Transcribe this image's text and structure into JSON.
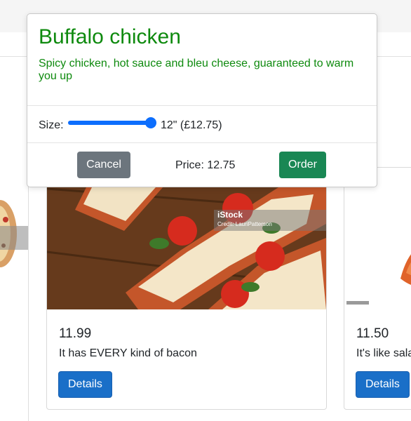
{
  "modal": {
    "title": "Buffalo chicken",
    "description": "Spicy chicken, hot sauce and bleu cheese, guaranteed to warm you up",
    "size_label": "Size:",
    "size_slider_level": 1.0,
    "size_value": "12\" (£12.75)",
    "cancel_label": "Cancel",
    "price_text": "Price: 12.75",
    "order_label": "Order",
    "colors": {
      "title": "#0e8a0e",
      "cancel": "#6c757d",
      "order": "#198754",
      "slider": "#0d6efd"
    }
  },
  "cards": [
    {
      "image_watermark": "iStock",
      "image_credit": "Credit: LauriPatterson",
      "price": "11.99",
      "description": "It has EVERY kind of bacon",
      "details_label": "Details"
    },
    {
      "price": "11.50",
      "description": "It's like sala",
      "details_label": "Details"
    }
  ]
}
